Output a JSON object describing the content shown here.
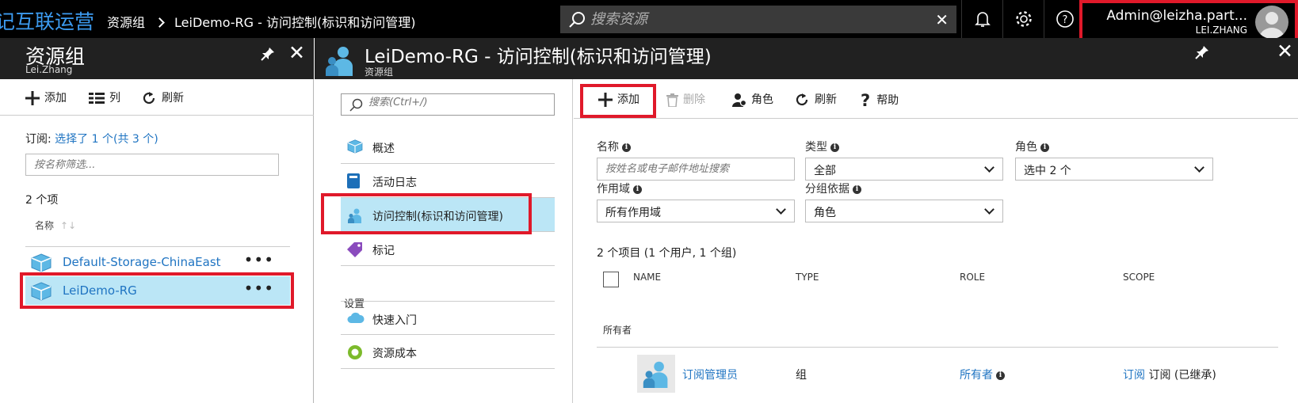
{
  "topbar": {
    "brand": "记互联运营",
    "breadcrumb": [
      "资源组",
      "LeiDemo-RG - 访问控制(标识和访问管理)"
    ],
    "search_placeholder": "搜索资源",
    "search_clear": "✕",
    "user_name": "Admin@leizha.part...",
    "user_sub": "LEI.ZHANG"
  },
  "left_blade": {
    "title": "资源组",
    "subtitle": "Lei.Zhang",
    "close": "✕",
    "toolbar": {
      "add": "添加",
      "columns": "列",
      "refresh": "刷新"
    },
    "subscription_label": "订阅:",
    "subscription_link": "选择了 1 个(共 3 个)",
    "filter_placeholder": "按名称筛选...",
    "count": "2 个项",
    "col_name": "名称",
    "sort_glyph": "↑↓",
    "items": [
      {
        "name": "Default-Storage-ChinaEast",
        "more": "•••"
      },
      {
        "name": "LeiDemo-RG",
        "more": "•••"
      }
    ]
  },
  "main_blade": {
    "title": "LeiDemo-RG - 访问控制(标识和访问管理)",
    "subtitle": "资源组",
    "close": "✕",
    "menu": {
      "search_placeholder": "搜索(Ctrl+/)",
      "items": [
        "概述",
        "活动日志",
        "访问控制(标识和访问管理)",
        "标记"
      ],
      "section_settings": "设置",
      "settings_items": [
        "快速入门",
        "资源成本"
      ]
    },
    "toolbar": {
      "add": "添加",
      "delete": "删除",
      "roles": "角色",
      "refresh": "刷新",
      "help": "帮助"
    },
    "filters": {
      "name_label": "名称",
      "name_placeholder": "按姓名或电子邮件地址搜索",
      "type_label": "类型",
      "type_value": "全部",
      "role_label": "角色",
      "role_value": "选中 2 个",
      "scope_label": "作用域",
      "scope_value": "所有作用域",
      "group_label": "分组依据",
      "group_value": "角色"
    },
    "summary": "2 个项目 (1 个用户, 1 个组)",
    "table": {
      "headers": [
        "NAME",
        "TYPE",
        "ROLE",
        "SCOPE"
      ],
      "group": "所有者",
      "row": {
        "name": "订阅管理员",
        "type": "组",
        "role": "所有者",
        "scope_link": "订阅",
        "scope_text": "订阅 (已继承)"
      }
    }
  },
  "colors": {
    "accent": "#1f74c2",
    "highlight": "#bbe6f6",
    "annotation": "#e0192a",
    "header": "#212121"
  }
}
